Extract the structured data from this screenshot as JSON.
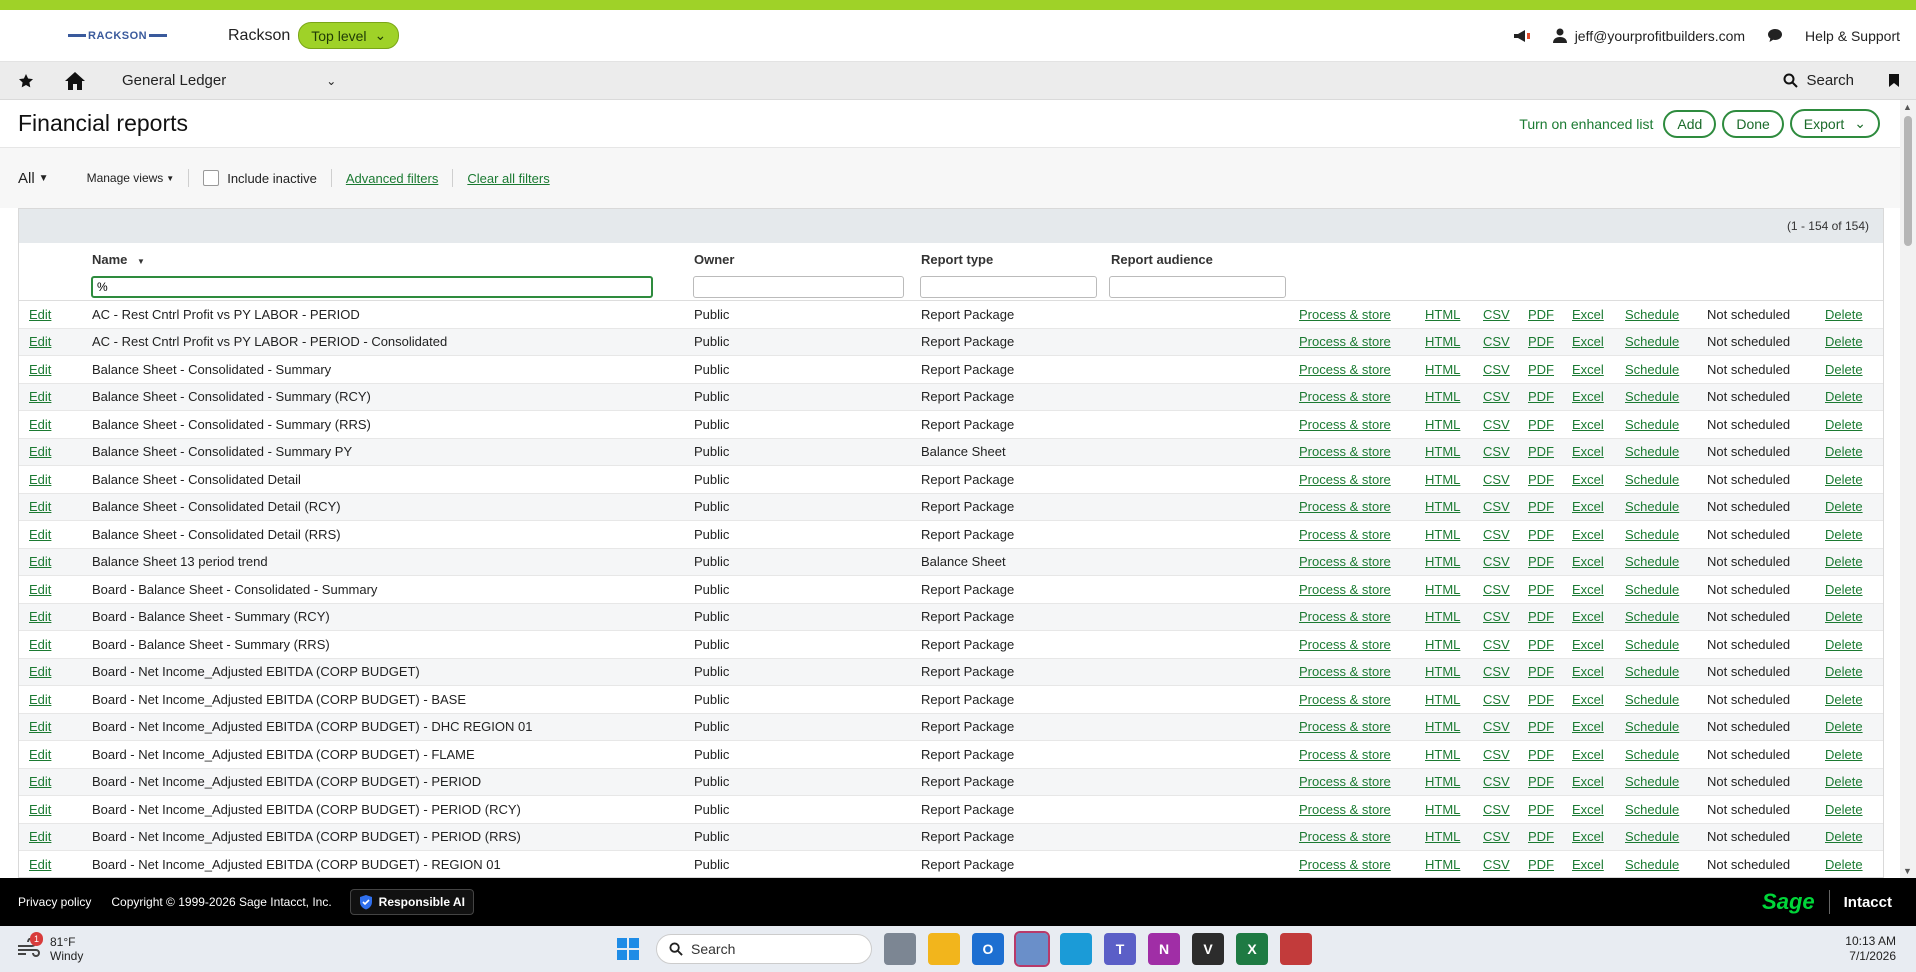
{
  "topbar": {
    "logo_text": "RACKSON",
    "company": "Rackson",
    "level": "Top level",
    "user_email": "jeff@yourprofitbuilders.com",
    "help": "Help & Support"
  },
  "navbar": {
    "module": "General Ledger",
    "search": "Search"
  },
  "page": {
    "title": "Financial reports",
    "enhanced_link": "Turn on enhanced list",
    "add": "Add",
    "done": "Done",
    "export": "Export"
  },
  "filters": {
    "view": "All",
    "manage_views": "Manage views",
    "include_inactive": "Include inactive",
    "advanced": "Advanced filters",
    "clear": "Clear all filters"
  },
  "grid": {
    "count": "(1 - 154 of 154)",
    "columns": {
      "name": "Name",
      "owner": "Owner",
      "report_type": "Report type",
      "audience": "Report audience"
    },
    "name_filter_value": "%",
    "action_labels": {
      "edit": "Edit",
      "process": "Process & store",
      "html": "HTML",
      "csv": "CSV",
      "pdf": "PDF",
      "excel": "Excel",
      "schedule": "Schedule",
      "delete": "Delete"
    },
    "rows": [
      {
        "name": "AC - Rest Cntrl Profit vs PY LABOR - PERIOD",
        "owner": "Public",
        "type": "Report Package",
        "status": "Not scheduled"
      },
      {
        "name": "AC - Rest Cntrl Profit vs PY LABOR - PERIOD - Consolidated",
        "owner": "Public",
        "type": "Report Package",
        "status": "Not scheduled"
      },
      {
        "name": "Balance Sheet - Consolidated - Summary",
        "owner": "Public",
        "type": "Report Package",
        "status": "Not scheduled"
      },
      {
        "name": "Balance Sheet - Consolidated - Summary (RCY)",
        "owner": "Public",
        "type": "Report Package",
        "status": "Not scheduled"
      },
      {
        "name": "Balance Sheet - Consolidated - Summary (RRS)",
        "owner": "Public",
        "type": "Report Package",
        "status": "Not scheduled"
      },
      {
        "name": "Balance Sheet - Consolidated - Summary PY",
        "owner": "Public",
        "type": "Balance Sheet",
        "status": "Not scheduled"
      },
      {
        "name": "Balance Sheet - Consolidated Detail",
        "owner": "Public",
        "type": "Report Package",
        "status": "Not scheduled"
      },
      {
        "name": "Balance Sheet - Consolidated Detail (RCY)",
        "owner": "Public",
        "type": "Report Package",
        "status": "Not scheduled"
      },
      {
        "name": "Balance Sheet - Consolidated Detail (RRS)",
        "owner": "Public",
        "type": "Report Package",
        "status": "Not scheduled"
      },
      {
        "name": "Balance Sheet 13 period trend",
        "owner": "Public",
        "type": "Balance Sheet",
        "status": "Not scheduled"
      },
      {
        "name": "Board - Balance Sheet - Consolidated - Summary",
        "owner": "Public",
        "type": "Report Package",
        "status": "Not scheduled"
      },
      {
        "name": "Board - Balance Sheet - Summary (RCY)",
        "owner": "Public",
        "type": "Report Package",
        "status": "Not scheduled"
      },
      {
        "name": "Board - Balance Sheet - Summary (RRS)",
        "owner": "Public",
        "type": "Report Package",
        "status": "Not scheduled"
      },
      {
        "name": "Board - Net Income_Adjusted EBITDA (CORP BUDGET)",
        "owner": "Public",
        "type": "Report Package",
        "status": "Not scheduled"
      },
      {
        "name": "Board - Net Income_Adjusted EBITDA (CORP BUDGET) - BASE",
        "owner": "Public",
        "type": "Report Package",
        "status": "Not scheduled"
      },
      {
        "name": "Board - Net Income_Adjusted EBITDA (CORP BUDGET) - DHC REGION 01",
        "owner": "Public",
        "type": "Report Package",
        "status": "Not scheduled"
      },
      {
        "name": "Board - Net Income_Adjusted EBITDA (CORP BUDGET) - FLAME",
        "owner": "Public",
        "type": "Report Package",
        "status": "Not scheduled"
      },
      {
        "name": "Board - Net Income_Adjusted EBITDA (CORP BUDGET) - PERIOD",
        "owner": "Public",
        "type": "Report Package",
        "status": "Not scheduled"
      },
      {
        "name": "Board - Net Income_Adjusted EBITDA (CORP BUDGET) - PERIOD (RCY)",
        "owner": "Public",
        "type": "Report Package",
        "status": "Not scheduled"
      },
      {
        "name": "Board - Net Income_Adjusted EBITDA (CORP BUDGET) - PERIOD (RRS)",
        "owner": "Public",
        "type": "Report Package",
        "status": "Not scheduled"
      },
      {
        "name": "Board - Net Income_Adjusted EBITDA (CORP BUDGET) - REGION 01",
        "owner": "Public",
        "type": "Report Package",
        "status": "Not scheduled"
      }
    ]
  },
  "footer": {
    "privacy": "Privacy policy",
    "copyright": "Copyright © 1999-2026 Sage Intacct, Inc.",
    "responsible_ai": "Responsible AI",
    "sage": "Sage",
    "intacct": "Intacct"
  },
  "taskbar": {
    "temp": "81°F",
    "weather": "Windy",
    "weather_badge": "1",
    "search": "Search",
    "time": "10:13 AM",
    "date": "7/1/2026"
  },
  "colors": {
    "accent": "#9fd228",
    "link": "#1b7a32",
    "sage_green": "#00d639"
  }
}
